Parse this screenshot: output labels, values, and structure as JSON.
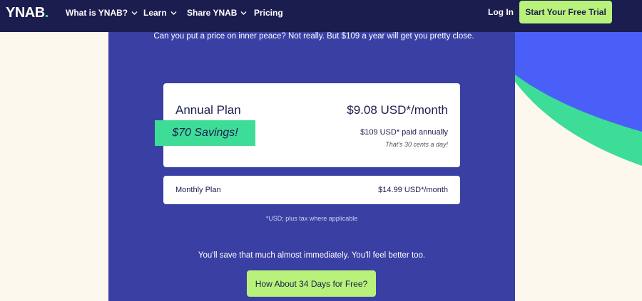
{
  "nav": {
    "logo_text": "YNAB",
    "logo_dot": ".",
    "items": [
      {
        "label": "What is YNAB?",
        "has_chevron": true
      },
      {
        "label": "Learn",
        "has_chevron": true
      },
      {
        "label": "Share YNAB",
        "has_chevron": true
      },
      {
        "label": "Pricing",
        "has_chevron": false
      }
    ],
    "login_label": "Log In",
    "trial_label": "Start Your Free Trial"
  },
  "pricing": {
    "tagline": "Can you put a price on inner peace? Not really. But $109 a year will get you pretty close.",
    "annual": {
      "title": "Annual Plan",
      "price": "$9.08 USD*/month",
      "billed": "$109 USD* paid annually",
      "note": "That's 30 cents a day!",
      "savings_badge": "$70 Savings!"
    },
    "monthly": {
      "title": "Monthly Plan",
      "price": "$14.99 USD*/month"
    },
    "footnote": "*USD; plus tax where applicable",
    "save_text": "You'll save that much almost immediately. You'll feel better too.",
    "cta_label": "How About 34 Days for Free?"
  },
  "colors": {
    "nav_bg": "#1c1d4f",
    "panel_bg": "#3a3fa3",
    "accent_green": "#b8f27a",
    "badge_green": "#3ddc97",
    "shape_blue": "#4a5ff7",
    "page_bg": "#fdf8ee"
  }
}
